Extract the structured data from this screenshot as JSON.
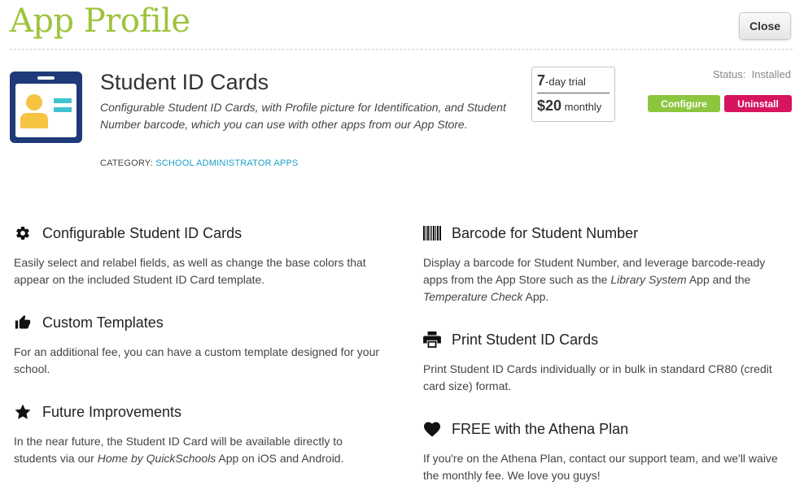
{
  "header": {
    "title": "App Profile",
    "close_label": "Close"
  },
  "app": {
    "name": "Student ID Cards",
    "description": "Configurable Student ID Cards, with Profile picture for Identification, and Student Number barcode, which you can use with other apps from our App Store.",
    "category_label": "CATEGORY:",
    "category_value": "SCHOOL ADMINISTRATOR APPS",
    "icon": "id-card-icon"
  },
  "pricing": {
    "trial_number": "7",
    "trial_text": "-day trial",
    "price": "$20",
    "period": "monthly"
  },
  "status": {
    "label": "Status:",
    "value": "Installed"
  },
  "actions": {
    "configure_label": "Configure",
    "uninstall_label": "Uninstall"
  },
  "features": {
    "configurable": {
      "title": "Configurable Student ID Cards",
      "body": "Easily select and relabel fields, as well as change the base colors that appear on the included Student ID Card template.",
      "icon": "gear-icon"
    },
    "custom_templates": {
      "title": "Custom Templates",
      "body": "For an additional fee, you can have a custom template designed for your school.",
      "icon": "thumbs-up-icon"
    },
    "future": {
      "title": "Future Improvements",
      "body_1": "In the near future, the Student ID Card will be available directly to students via our ",
      "body_em": "Home by QuickSchools",
      "body_2": " App on iOS and Android.",
      "icon": "star-icon"
    },
    "barcode": {
      "title": "Barcode for Student Number",
      "body_1": "Display a barcode for Student Number, and leverage barcode-ready apps from the App Store such as the ",
      "body_em1": "Library System",
      "body_2": " App and the ",
      "body_em2": "Temperature Check",
      "body_3": " App.",
      "icon": "barcode-icon"
    },
    "print": {
      "title": "Print Student ID Cards",
      "body": "Print Student ID Cards individually or in bulk in standard CR80 (credit card size) format.",
      "icon": "printer-icon"
    },
    "athena": {
      "title": "FREE with the Athena Plan",
      "body": "If you're on the Athena Plan, contact our support team, and we'll waive the monthly fee. We love you guys!",
      "icon": "heart-icon"
    }
  },
  "colors": {
    "title_green": "#9dc43a",
    "configure_green": "#8cc63f",
    "uninstall_red": "#d6145f",
    "category_link": "#1a9fc9",
    "icon_navy": "#1e3a78",
    "icon_yellow": "#f6c343",
    "icon_teal": "#3fc4d0"
  }
}
